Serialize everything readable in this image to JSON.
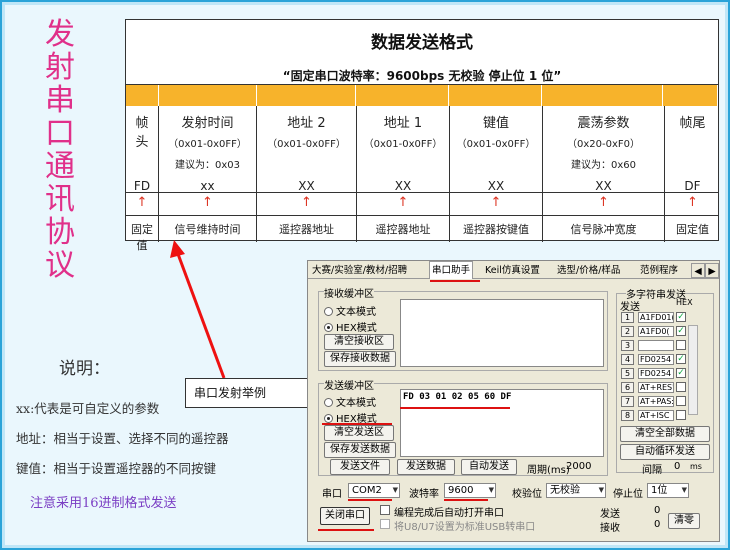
{
  "side_title": [
    "发",
    "射",
    "串",
    "口",
    "通",
    "讯",
    "协",
    "议"
  ],
  "protocol": {
    "title": "数据发送格式",
    "subtitle": "“固定串口波特率：9600bps   无校验   停止位 1 位”",
    "columns": [
      {
        "header": "帧\n头",
        "range": "",
        "suggest": "",
        "value": "FD",
        "desc": "固定值"
      },
      {
        "header": "发射时间",
        "range": "（0x01-0x0FF）",
        "suggest": "建议为：0x03",
        "value": "xx",
        "desc": "信号维持时间"
      },
      {
        "header": "地址 2",
        "range": "（0x01-0x0FF）",
        "suggest": "",
        "value": "XX",
        "desc": "遥控器地址"
      },
      {
        "header": "地址 1",
        "range": "（0x01-0x0FF）",
        "suggest": "",
        "value": "XX",
        "desc": "遥控器地址"
      },
      {
        "header": "键值",
        "range": "（0x01-0x0FF）",
        "suggest": "",
        "value": "XX",
        "desc": "遥控器按键值"
      },
      {
        "header": "震荡参数",
        "range": "（0x20-0xF0）",
        "suggest": "建议为：0x60",
        "value": "XX",
        "desc": "信号脉冲宽度"
      },
      {
        "header": "帧尾",
        "range": "",
        "suggest": "",
        "value": "DF",
        "desc": "固定值"
      }
    ],
    "arrow": "↑"
  },
  "notes": {
    "title": "说明：",
    "lines": [
      "xx:代表是可自定义的参数",
      "地址：相当于设置、选择不同的遥控器",
      "键值：相当于设置遥控器的不同按键"
    ],
    "highlight": "注意采用16进制格式发送"
  },
  "callout": "串口发射举例",
  "serial": {
    "tabs": [
      "大赛/实验室/教材/招聘",
      "串口助手",
      "Keil仿真设置",
      "选型/价格/样品",
      "范例程序"
    ],
    "recv": {
      "title": "接收缓冲区",
      "text_mode": "文本模式",
      "hex_mode": "HEX模式",
      "clear_btn": "清空接收区",
      "save_btn": "保存接收数据"
    },
    "send": {
      "title": "发送缓冲区",
      "text_mode": "文本模式",
      "hex_mode": "HEX模式",
      "content": "FD 03 01 02 05 60 DF",
      "clear_btn": "清空发送区",
      "save_btn": "保存发送数据",
      "send_file_btn": "发送文件",
      "send_data_btn": "发送数据",
      "auto_send_btn": "自动发送",
      "period_label": "周期(ms)",
      "period_value": "2000"
    },
    "multi": {
      "title": "多字符串发送",
      "send_label": "发送",
      "hex_label": "HEX",
      "rows": [
        {
          "n": "1",
          "text": "A1FD01(",
          "hex": true
        },
        {
          "n": "2",
          "text": "A1FD0(",
          "hex": true
        },
        {
          "n": "3",
          "text": "",
          "hex": false
        },
        {
          "n": "4",
          "text": "FD0254",
          "hex": true
        },
        {
          "n": "5",
          "text": "FD0254",
          "hex": true
        },
        {
          "n": "6",
          "text": "AT+RES'",
          "hex": false
        },
        {
          "n": "7",
          "text": "AT+PAS:",
          "hex": false
        },
        {
          "n": "8",
          "text": "AT+ISC",
          "hex": false
        }
      ],
      "clear_all_btn": "清空全部数据",
      "auto_loop_btn": "自动循环发送",
      "interval_label": "间隔",
      "interval_value": "0",
      "interval_unit": "ms"
    },
    "bottom": {
      "port_label": "串口",
      "port_value": "COM2",
      "baud_label": "波特率",
      "baud_value": "9600",
      "parity_label": "校验位",
      "parity_value": "无校验",
      "stop_label": "停止位",
      "stop_value": "1位",
      "close_btn": "关闭串口",
      "opt1": "编程完成后自动打开串口",
      "opt2": "将U8/U7设置为标准USB转串口",
      "send_label": "发送",
      "send_count": "0",
      "recv_label": "接收",
      "recv_count": "0",
      "clear_btn": "清零"
    }
  }
}
